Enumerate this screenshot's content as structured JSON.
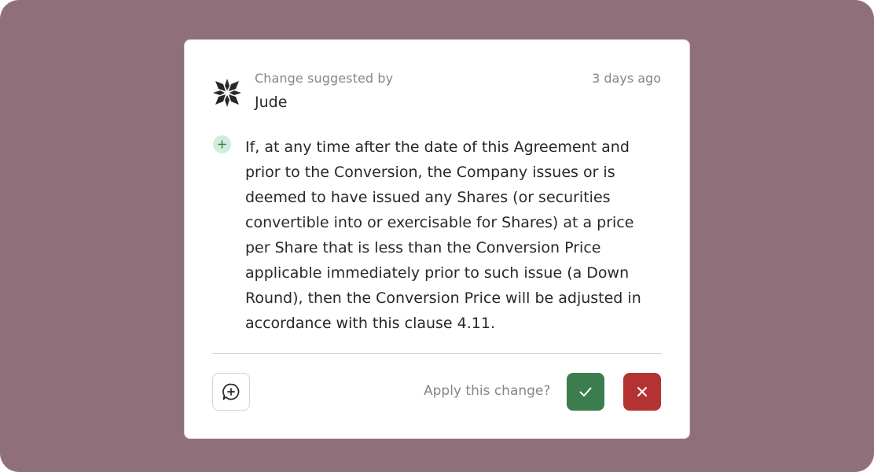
{
  "suggestion": {
    "header_label": "Change suggested by",
    "author": "Jude",
    "timestamp": "3 days ago",
    "change_type_icon": "plus-icon",
    "text": "If, at any time after the date of this Agreement and prior to the Conversion, the Company issues or is deemed to have issued any Shares (or securities convertible into or exercisable for Shares) at a price per Share that is less than the Conversion Price applicable immediately prior to such issue (a Down Round), then the Conversion Price will be adjusted in accordance with this clause 4.11."
  },
  "actions": {
    "prompt": "Apply this change?",
    "comment_icon": "add-comment-icon",
    "accept_icon": "check-icon",
    "reject_icon": "close-icon"
  },
  "colors": {
    "background": "#8f707a",
    "card": "#ffffff",
    "accept": "#3b7d4d",
    "reject": "#b33333",
    "addition_badge": "#cfeedd"
  }
}
